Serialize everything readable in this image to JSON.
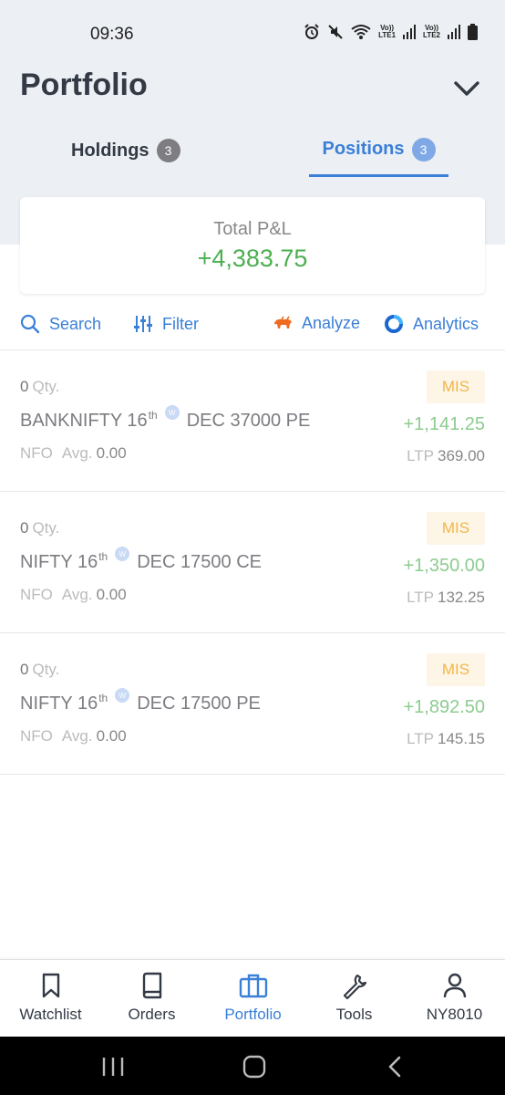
{
  "status_bar": {
    "time": "09:36",
    "icons": [
      "alarm-icon",
      "mute-icon",
      "wifi-icon",
      "lte1-signal-icon",
      "lte2-signal-icon",
      "battery-icon"
    ],
    "lte1": "Vo)) LTE1",
    "lte2": "Vo)) LTE2"
  },
  "header": {
    "title": "Portfolio",
    "menu_icon": "chevron-down-icon"
  },
  "tabs": [
    {
      "label": "Holdings",
      "count": "3",
      "active": false
    },
    {
      "label": "Positions",
      "count": "3",
      "active": true
    }
  ],
  "summary": {
    "label": "Total P&L",
    "value": "+4,383.75"
  },
  "toolbar": {
    "search": "Search",
    "filter": "Filter",
    "analyze": "Analyze",
    "analytics": "Analytics"
  },
  "positions": [
    {
      "qty": "0",
      "qty_unit": "Qty.",
      "product": "MIS",
      "symbol": "BANKNIFTY 16",
      "sup": "th",
      "weekly_badge": "W",
      "rest": "DEC 37000 PE",
      "pnl": "+1,141.25",
      "exchange": "NFO",
      "avg_label": "Avg.",
      "avg": "0.00",
      "ltp_label": "LTP",
      "ltp": "369.00"
    },
    {
      "qty": "0",
      "qty_unit": "Qty.",
      "product": "MIS",
      "symbol": "NIFTY 16",
      "sup": "th",
      "weekly_badge": "W",
      "rest": "DEC 17500 CE",
      "pnl": "+1,350.00",
      "exchange": "NFO",
      "avg_label": "Avg.",
      "avg": "0.00",
      "ltp_label": "LTP",
      "ltp": "132.25"
    },
    {
      "qty": "0",
      "qty_unit": "Qty.",
      "product": "MIS",
      "symbol": "NIFTY 16",
      "sup": "th",
      "weekly_badge": "W",
      "rest": "DEC 17500 PE",
      "pnl": "+1,892.50",
      "exchange": "NFO",
      "avg_label": "Avg.",
      "avg": "0.00",
      "ltp_label": "LTP",
      "ltp": "145.15"
    }
  ],
  "bottom_nav": [
    {
      "label": "Watchlist",
      "icon": "bookmark-icon",
      "active": false
    },
    {
      "label": "Orders",
      "icon": "book-icon",
      "active": false
    },
    {
      "label": "Portfolio",
      "icon": "briefcase-icon",
      "active": true
    },
    {
      "label": "Tools",
      "icon": "wrench-icon",
      "active": false
    },
    {
      "label": "NY8010",
      "icon": "user-icon",
      "active": false
    }
  ],
  "colors": {
    "accent": "#3a7fd8",
    "profit": "#4caf50",
    "product_badge": "#f2b54a",
    "header_bg": "#eceff3"
  }
}
